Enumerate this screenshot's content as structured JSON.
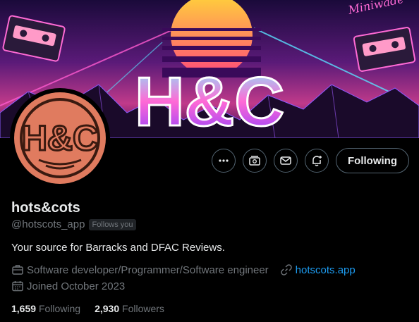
{
  "banner": {
    "signature": "Miniwade",
    "logo_text": "H&C"
  },
  "avatar": {
    "logo_text": "H&C"
  },
  "actions": {
    "following_label": "Following",
    "icons": [
      "more-icon",
      "subscribe-icon",
      "message-icon",
      "notify-icon"
    ]
  },
  "profile": {
    "name": "hots&cots",
    "handle": "@hotscots_app",
    "follows_you": "Follows you",
    "bio": "Your source for Barracks and DFAC Reviews.",
    "profession": "Software developer/Programmer/Software engineer",
    "website": "hotscots.app",
    "joined": "Joined October 2023"
  },
  "stats": {
    "following_count": "1,659",
    "following_label": "Following",
    "followers_count": "2,930",
    "followers_label": "Followers"
  },
  "colors": {
    "background": "#000000",
    "text_primary": "#e7e9ea",
    "text_secondary": "#71767b",
    "link": "#1d9bf0",
    "avatar_bg": "#e07b5f"
  }
}
